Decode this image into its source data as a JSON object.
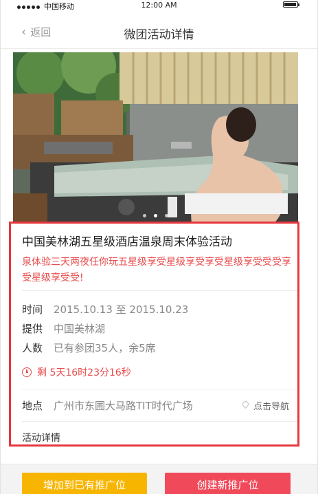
{
  "status_bar": {
    "carrier": "中国移动",
    "time": "12:00 AM"
  },
  "nav": {
    "back_label": "返回",
    "title": "微团活动详情"
  },
  "hero": {
    "image_desc": "woman-in-hot-spring-pool",
    "slides": 3,
    "active_slide": 1
  },
  "event": {
    "title": "中国美林湖五星级酒店温泉周末体验活动",
    "description": "泉体验三天两夜任你玩五星级享受星级享受享受星级享受受受享受星级享受受!",
    "time_label": "时间",
    "time_value": "2015.10.13 至 2015.10.23",
    "provider_label": "提供",
    "provider_value": "中国美林湖",
    "count_label": "人数",
    "count_value": "已有参团35人，余5席",
    "countdown": "剩 5天16时23分16秒",
    "location_label": "地点",
    "location_value": "广州市东圃大马路TIT时代广场",
    "navigate_label": "点击导航",
    "detail_label": "活动详情"
  },
  "actions": {
    "add_existing": "增加到已有推广位",
    "create_new": "创建新推广位"
  },
  "colors": {
    "accent_red": "#e94b4b",
    "highlight_box": "#e8363d",
    "button_yellow": "#f7b500",
    "button_red": "#f04a5a"
  }
}
